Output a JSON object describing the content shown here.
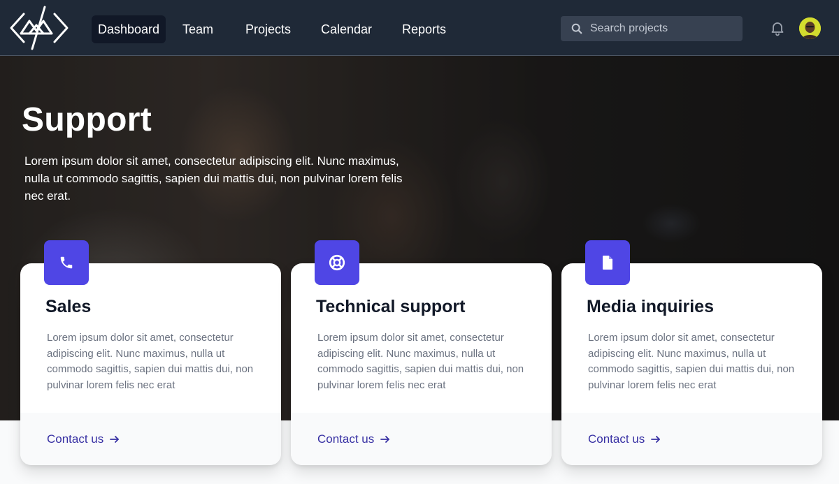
{
  "nav": {
    "links": [
      {
        "label": "Dashboard",
        "active": true
      },
      {
        "label": "Team",
        "active": false
      },
      {
        "label": "Projects",
        "active": false
      },
      {
        "label": "Calendar",
        "active": false
      },
      {
        "label": "Reports",
        "active": false
      }
    ],
    "search": {
      "placeholder": "Search projects",
      "icon": "search-icon"
    },
    "notification_icon": "bell-icon",
    "avatar": "user-avatar"
  },
  "hero": {
    "title": "Support",
    "description": "Lorem ipsum dolor sit amet, consectetur adipiscing elit. Nunc maximus, nulla ut commodo sagittis, sapien dui mattis dui, non pulvinar lorem felis nec erat."
  },
  "cards": [
    {
      "icon": "phone-icon",
      "title": "Sales",
      "text": "Lorem ipsum dolor sit amet, consectetur adipiscing elit. Nunc maximus, nulla ut commodo sagittis, sapien dui mattis dui, non pulvinar lorem felis nec erat",
      "link": "Contact us"
    },
    {
      "icon": "lifebuoy-icon",
      "title": "Technical support",
      "text": "Lorem ipsum dolor sit amet, consectetur adipiscing elit. Nunc maximus, nulla ut commodo sagittis, sapien dui mattis dui, non pulvinar lorem felis nec erat",
      "link": "Contact us"
    },
    {
      "icon": "document-icon",
      "title": "Media inquiries",
      "text": "Lorem ipsum dolor sit amet, consectetur adipiscing elit. Nunc maximus, nulla ut commodo sagittis, sapien dui mattis dui, non pulvinar lorem felis nec erat",
      "link": "Contact us"
    }
  ],
  "colors": {
    "nav_bg": "#1f2937",
    "accent": "#4f46e5",
    "link": "#3730a3"
  }
}
